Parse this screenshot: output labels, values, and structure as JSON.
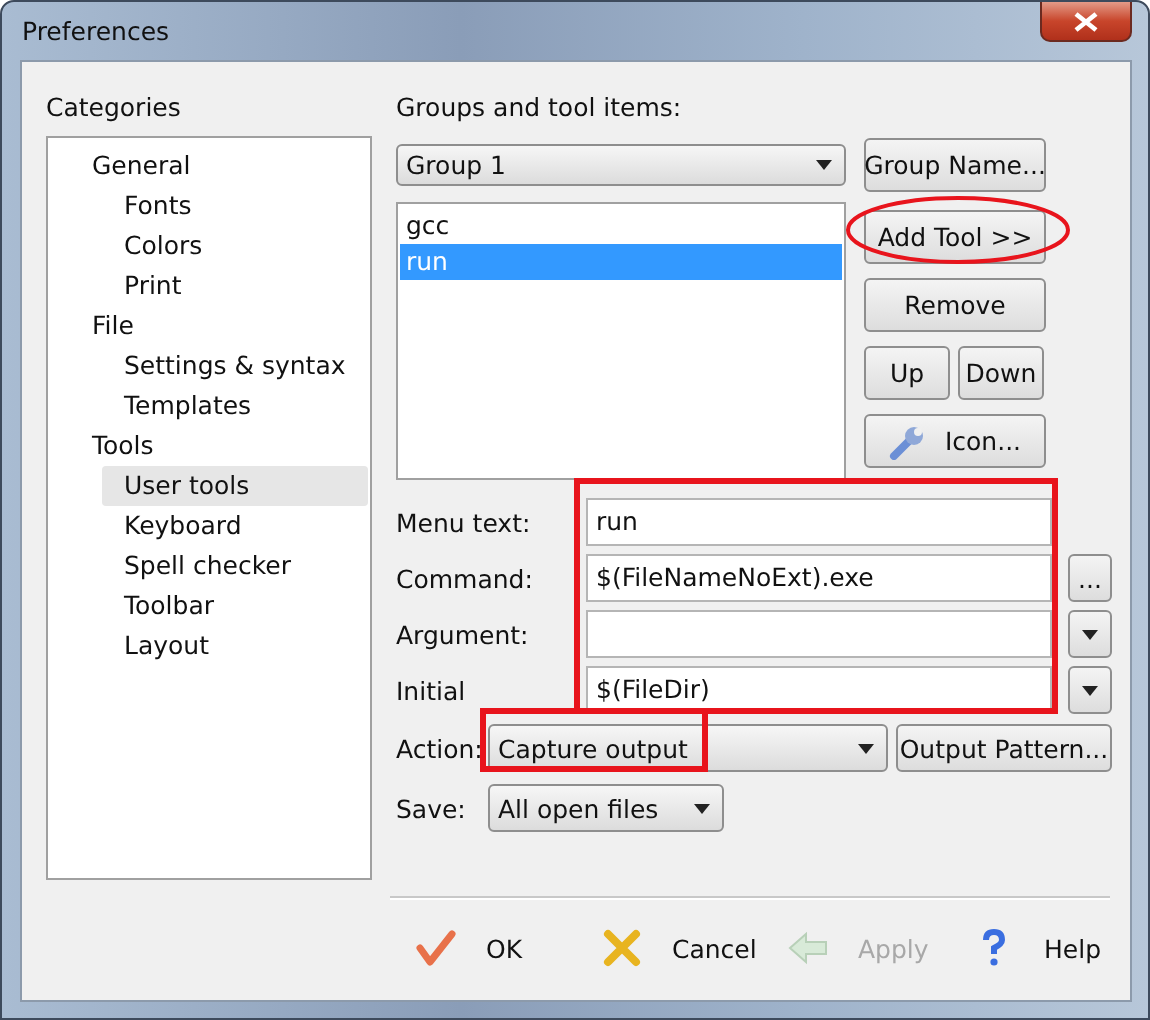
{
  "window": {
    "title": "Preferences"
  },
  "categories": {
    "label": "Categories",
    "items": [
      {
        "label": "General",
        "selected": false,
        "children": [
          {
            "label": "Fonts",
            "selected": false
          },
          {
            "label": "Colors",
            "selected": false
          },
          {
            "label": "Print",
            "selected": false
          }
        ]
      },
      {
        "label": "File",
        "selected": false,
        "children": [
          {
            "label": "Settings & syntax",
            "selected": false
          },
          {
            "label": "Templates",
            "selected": false
          }
        ]
      },
      {
        "label": "Tools",
        "selected": false,
        "children": [
          {
            "label": "User tools",
            "selected": true
          },
          {
            "label": "Keyboard",
            "selected": false
          },
          {
            "label": "Spell checker",
            "selected": false
          },
          {
            "label": "Toolbar",
            "selected": false
          },
          {
            "label": "Layout",
            "selected": false
          }
        ]
      }
    ]
  },
  "groups": {
    "label": "Groups and tool items:",
    "group_select": "Group 1",
    "items": [
      {
        "label": "gcc",
        "selected": false
      },
      {
        "label": "run",
        "selected": true
      }
    ],
    "group_name_button": "Group Name...",
    "add_tool_button": "Add Tool >>",
    "remove_button": "Remove",
    "up_button": "Up",
    "down_button": "Down",
    "icon_button": "Icon..."
  },
  "fields": [
    {
      "label": "Menu text:",
      "value": "run",
      "kind": "text"
    },
    {
      "label": "Command:",
      "value": "$(FileNameNoExt).exe",
      "kind": "browse",
      "button": "..."
    },
    {
      "label": "Argument:",
      "kind": "dropdown"
    },
    {
      "label": "Initial",
      "value": "$(FileDir)",
      "kind": "dropdown"
    }
  ],
  "action": {
    "label": "Action:",
    "value": "Capture output",
    "button": "Output Pattern..."
  },
  "save": {
    "label": "Save:",
    "value": "All open files"
  },
  "dialog_buttons": [
    {
      "label": "OK",
      "kind": "ok",
      "disabled": false
    },
    {
      "label": "Cancel",
      "kind": "cancel",
      "disabled": false
    },
    {
      "label": "Apply",
      "kind": "apply",
      "disabled": true
    },
    {
      "label": "Help",
      "kind": "help",
      "disabled": false
    }
  ]
}
